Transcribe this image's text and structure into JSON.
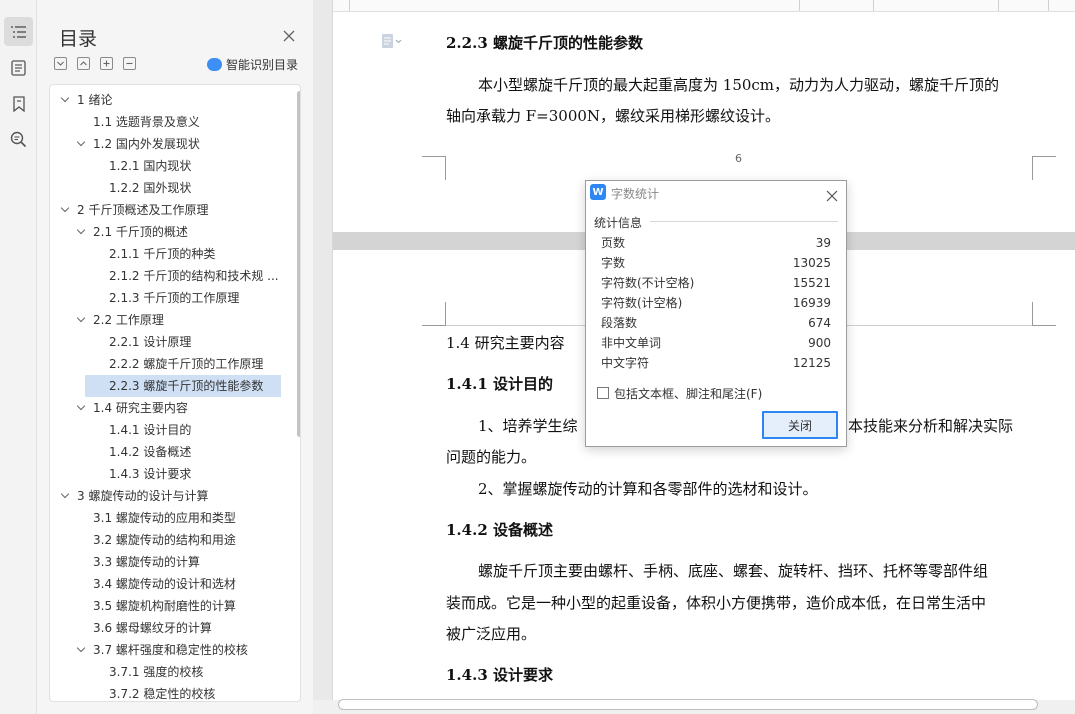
{
  "sidebar_icons": [
    "outline-icon",
    "list-icon",
    "bookmark-icon",
    "search-doc-icon"
  ],
  "toc": {
    "title": "目录",
    "smart_label": "智能识别目录",
    "items": [
      {
        "label": "1 绪论",
        "level": 1,
        "expanded": true,
        "selected": false
      },
      {
        "label": "1.1 选题背景及意义",
        "level": 2,
        "expanded": false,
        "selected": false
      },
      {
        "label": "1.2 国内外发展现状",
        "level": 2,
        "expanded": true,
        "selected": false
      },
      {
        "label": "1.2.1 国内现状",
        "level": 3,
        "expanded": false,
        "selected": false
      },
      {
        "label": "1.2.2 国外现状",
        "level": 3,
        "expanded": false,
        "selected": false
      },
      {
        "label": "2 千斤顶概述及工作原理",
        "level": 1,
        "expanded": true,
        "selected": false
      },
      {
        "label": "2.1 千斤顶的概述",
        "level": 2,
        "expanded": true,
        "selected": false
      },
      {
        "label": "2.1.1 千斤顶的种类",
        "level": 3,
        "expanded": false,
        "selected": false
      },
      {
        "label": "2.1.2 千斤顶的结构和技术规 ...",
        "level": 3,
        "expanded": false,
        "selected": false
      },
      {
        "label": "2.1.3 千斤顶的工作原理",
        "level": 3,
        "expanded": false,
        "selected": false
      },
      {
        "label": "2.2 工作原理",
        "level": 2,
        "expanded": true,
        "selected": false
      },
      {
        "label": "2.2.1 设计原理",
        "level": 3,
        "expanded": false,
        "selected": false
      },
      {
        "label": "2.2.2 螺旋千斤顶的工作原理",
        "level": 3,
        "expanded": false,
        "selected": false
      },
      {
        "label": "2.2.3  螺旋千斤顶的性能参数",
        "level": 3,
        "expanded": false,
        "selected": true
      },
      {
        "label": "1.4 研究主要内容",
        "level": 2,
        "expanded": true,
        "selected": false
      },
      {
        "label": "1.4.1 设计目的",
        "level": 3,
        "expanded": false,
        "selected": false
      },
      {
        "label": "1.4.2 设备概述",
        "level": 3,
        "expanded": false,
        "selected": false
      },
      {
        "label": "1.4.3 设计要求",
        "level": 3,
        "expanded": false,
        "selected": false
      },
      {
        "label": "3 螺旋传动的设计与计算",
        "level": 1,
        "expanded": true,
        "selected": false
      },
      {
        "label": "3.1 螺旋传动的应用和类型",
        "level": 2,
        "expanded": false,
        "selected": false
      },
      {
        "label": "3.2 螺旋传动的结构和用途",
        "level": 2,
        "expanded": false,
        "selected": false
      },
      {
        "label": "3.3 螺旋传动的计算",
        "level": 2,
        "expanded": false,
        "selected": false
      },
      {
        "label": "3.4 螺旋传动的设计和选材",
        "level": 2,
        "expanded": false,
        "selected": false
      },
      {
        "label": "3.5 螺旋机构耐磨性的计算",
        "level": 2,
        "expanded": false,
        "selected": false
      },
      {
        "label": "3.6 螺母螺纹牙的计算",
        "level": 2,
        "expanded": false,
        "selected": false
      },
      {
        "label": "3.7 螺杆强度和稳定性的校核",
        "level": 2,
        "expanded": true,
        "selected": false
      },
      {
        "label": "3.7.1 强度的校核",
        "level": 3,
        "expanded": false,
        "selected": false
      },
      {
        "label": "3.7.2 稳定性的校核",
        "level": 3,
        "expanded": false,
        "selected": false
      }
    ]
  },
  "document": {
    "page1": {
      "heading": "2.2.3  螺旋千斤顶的性能参数",
      "para_line1": "本小型螺旋千斤顶的最大起重高度为 150cm，动力为人力驱动，螺旋千斤顶的",
      "para_line2": "轴向承载力 F=3000N，螺纹采用梯形螺纹设计。",
      "page_number": "6"
    },
    "page2": {
      "section": "1.4 研究主要内容",
      "h_141": "1.4.1 设计目的",
      "p1_line1_left": "1、培养学生综",
      "p1_line1_right": "本技能来分析和解决实际",
      "p1_line2": "问题的能力。",
      "p2": "2、掌握螺旋传动的计算和各零部件的选材和设计。",
      "h_142": "1.4.2 设备概述",
      "p3_line1": "螺旋千斤顶主要由螺杆、手柄、底座、螺套、旋转杆、挡环、托杯等零部件组",
      "p3_line2": "装而成。它是一种小型的起重设备，体积小方便携带，造价成本低，在日常生活中",
      "p3_line3": "被广泛应用。",
      "h_143": "1.4.3 设计要求"
    }
  },
  "dialog": {
    "logo": "W",
    "title": "字数统计",
    "group_label": "统计信息",
    "stats": [
      {
        "label": "页数",
        "value": "39"
      },
      {
        "label": "字数",
        "value": "13025"
      },
      {
        "label": "字符数(不计空格)",
        "value": "15521"
      },
      {
        "label": "字符数(计空格)",
        "value": "16939"
      },
      {
        "label": "段落数",
        "value": "674"
      },
      {
        "label": "非中文单词",
        "value": "900"
      },
      {
        "label": "中文字符",
        "value": "12125"
      }
    ],
    "checkbox_label": "包括文本框、脚注和尾注(F)",
    "checkbox_checked": false,
    "close_label": "关闭"
  }
}
